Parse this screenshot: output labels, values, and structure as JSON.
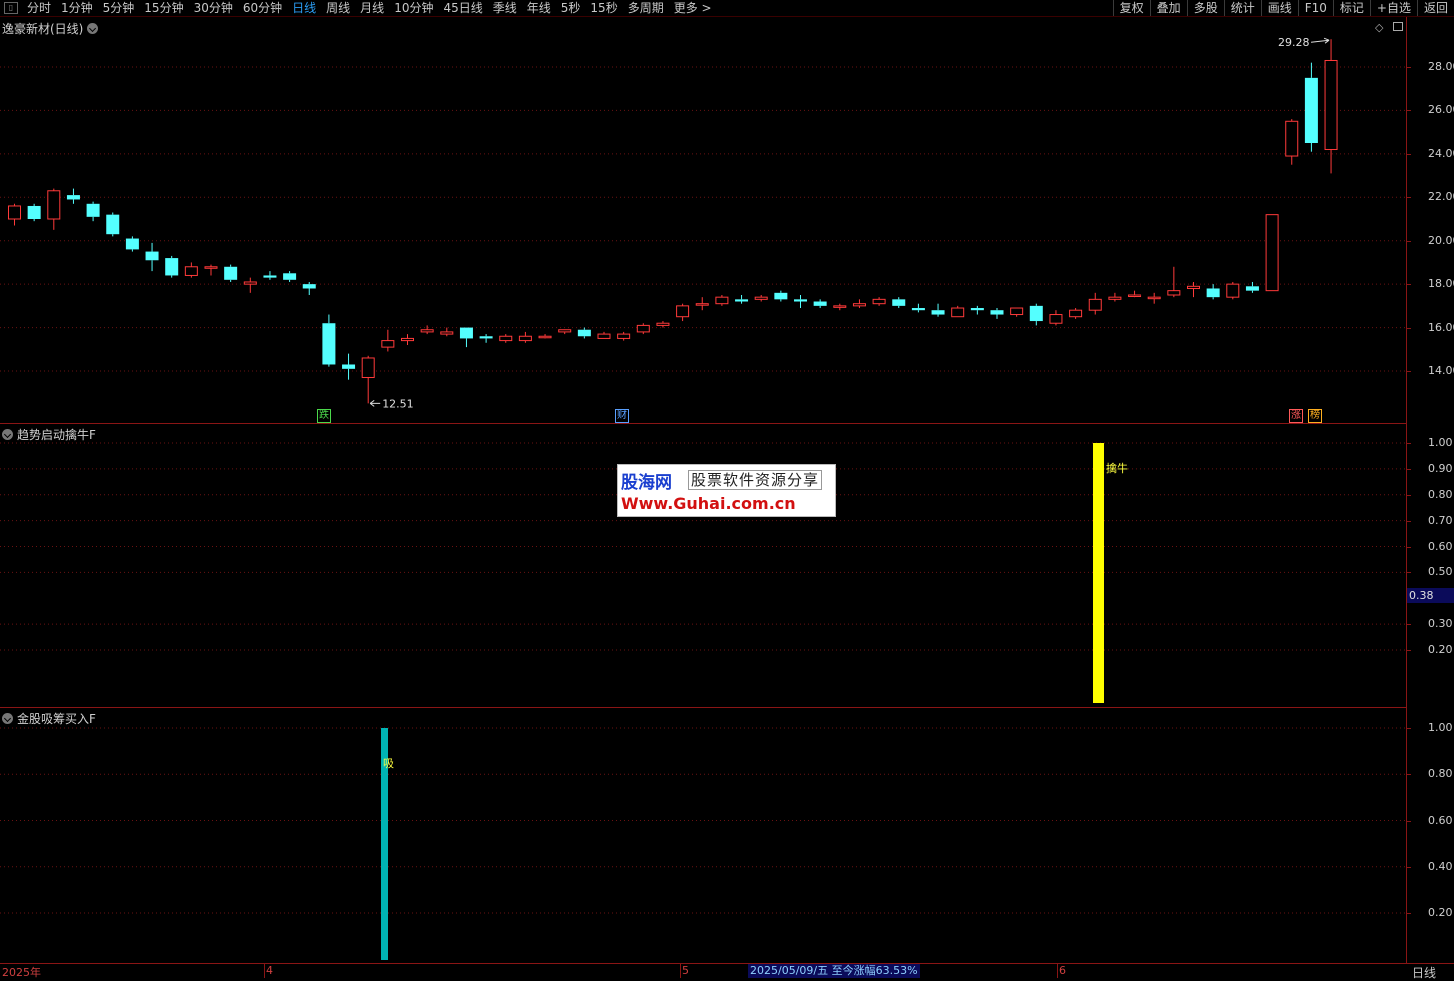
{
  "toolbar": {
    "periods": [
      "分时",
      "1分钟",
      "5分钟",
      "15分钟",
      "30分钟",
      "60分钟",
      "日线",
      "周线",
      "月线",
      "10分钟",
      "45日线",
      "季线",
      "年线",
      "5秒",
      "15秒",
      "多周期",
      "更多 >"
    ],
    "active_period": "日线",
    "right_buttons": [
      "复权",
      "叠加",
      "多股",
      "统计",
      "画线",
      "F10",
      "标记",
      "+自选",
      "返回"
    ]
  },
  "main_panel": {
    "title": "逸豪新材(日线)",
    "price_axis": [
      "28.00",
      "26.00",
      "24.00",
      "22.00",
      "20.00",
      "18.00",
      "16.00",
      "14.00"
    ],
    "high_label": "29.28",
    "low_label": "12.51",
    "markers": [
      {
        "text": "跌",
        "color": "#4bd84b"
      },
      {
        "text": "财",
        "color": "#5aa0ff"
      },
      {
        "text": "涨",
        "color": "#ff5a5a"
      },
      {
        "text": "榜",
        "color": "#ffb020"
      }
    ]
  },
  "indicator1": {
    "title": "趋势启动擒牛F",
    "axis": [
      "1.00",
      "0.90",
      "0.80",
      "0.70",
      "0.60",
      "0.50",
      "0.30",
      "0.20"
    ],
    "current_value": "0.38",
    "signal_label": "擒牛",
    "signal_color": "#ffff00"
  },
  "indicator2": {
    "title": "金股吸筹买入F",
    "axis": [
      "1.00",
      "0.80",
      "0.60",
      "0.40",
      "0.20"
    ],
    "signal_label": "吸",
    "signal_color": "#00b4b4"
  },
  "watermark": {
    "logo": "股海网",
    "slogan": "股票软件资源分享",
    "url": "Www.Guhai.com.cn"
  },
  "bottom": {
    "dates": [
      "2025年",
      "4",
      "5",
      "6"
    ],
    "status_note": "2025/05/09/五  至今涨幅63.53%",
    "period_button": "日线"
  },
  "colors": {
    "up": "#ff3a3a",
    "down": "#54ffff",
    "grid": "#8a1515"
  },
  "chart_data": {
    "type": "candlestick",
    "candles": [
      {
        "o": 21.0,
        "c": 21.6,
        "h": 21.7,
        "l": 20.7
      },
      {
        "o": 21.6,
        "c": 21.0,
        "h": 21.7,
        "l": 20.9
      },
      {
        "o": 21.0,
        "c": 22.3,
        "h": 22.4,
        "l": 20.5
      },
      {
        "o": 22.1,
        "c": 21.9,
        "h": 22.4,
        "l": 21.7
      },
      {
        "o": 21.7,
        "c": 21.1,
        "h": 21.8,
        "l": 20.9
      },
      {
        "o": 21.2,
        "c": 20.3,
        "h": 21.3,
        "l": 20.2
      },
      {
        "o": 20.1,
        "c": 19.6,
        "h": 20.2,
        "l": 19.5
      },
      {
        "o": 19.5,
        "c": 19.1,
        "h": 19.9,
        "l": 18.6
      },
      {
        "o": 19.2,
        "c": 18.4,
        "h": 19.3,
        "l": 18.3
      },
      {
        "o": 18.4,
        "c": 18.8,
        "h": 19.0,
        "l": 18.3
      },
      {
        "o": 18.8,
        "c": 18.8,
        "h": 18.9,
        "l": 18.4
      },
      {
        "o": 18.8,
        "c": 18.2,
        "h": 18.9,
        "l": 18.1
      },
      {
        "o": 18.0,
        "c": 18.1,
        "h": 18.3,
        "l": 17.6
      },
      {
        "o": 18.4,
        "c": 18.3,
        "h": 18.6,
        "l": 18.2
      },
      {
        "o": 18.5,
        "c": 18.2,
        "h": 18.6,
        "l": 18.1
      },
      {
        "o": 18.0,
        "c": 17.8,
        "h": 18.1,
        "l": 17.5
      },
      {
        "o": 16.2,
        "c": 14.3,
        "h": 16.6,
        "l": 14.2
      },
      {
        "o": 14.3,
        "c": 14.1,
        "h": 14.8,
        "l": 13.6
      },
      {
        "o": 13.7,
        "c": 14.6,
        "h": 14.7,
        "l": 12.51
      },
      {
        "o": 15.1,
        "c": 15.4,
        "h": 15.9,
        "l": 14.9
      },
      {
        "o": 15.4,
        "c": 15.5,
        "h": 15.7,
        "l": 15.2
      },
      {
        "o": 15.8,
        "c": 15.9,
        "h": 16.1,
        "l": 15.7
      },
      {
        "o": 15.7,
        "c": 15.8,
        "h": 16.0,
        "l": 15.6
      },
      {
        "o": 16.0,
        "c": 15.5,
        "h": 16.0,
        "l": 15.1
      },
      {
        "o": 15.6,
        "c": 15.5,
        "h": 15.7,
        "l": 15.3
      },
      {
        "o": 15.4,
        "c": 15.6,
        "h": 15.7,
        "l": 15.3
      },
      {
        "o": 15.4,
        "c": 15.6,
        "h": 15.8,
        "l": 15.3
      },
      {
        "o": 15.6,
        "c": 15.6,
        "h": 15.7,
        "l": 15.5
      },
      {
        "o": 15.8,
        "c": 15.9,
        "h": 15.9,
        "l": 15.7
      },
      {
        "o": 15.9,
        "c": 15.6,
        "h": 16.0,
        "l": 15.5
      },
      {
        "o": 15.5,
        "c": 15.7,
        "h": 15.8,
        "l": 15.5
      },
      {
        "o": 15.5,
        "c": 15.7,
        "h": 15.8,
        "l": 15.4
      },
      {
        "o": 15.8,
        "c": 16.1,
        "h": 16.2,
        "l": 15.7
      },
      {
        "o": 16.1,
        "c": 16.2,
        "h": 16.3,
        "l": 16.0
      },
      {
        "o": 16.5,
        "c": 17.0,
        "h": 17.1,
        "l": 16.3
      },
      {
        "o": 17.1,
        "c": 17.1,
        "h": 17.4,
        "l": 16.8
      },
      {
        "o": 17.1,
        "c": 17.4,
        "h": 17.5,
        "l": 17.0
      },
      {
        "o": 17.3,
        "c": 17.2,
        "h": 17.5,
        "l": 17.1
      },
      {
        "o": 17.3,
        "c": 17.4,
        "h": 17.5,
        "l": 17.2
      },
      {
        "o": 17.6,
        "c": 17.3,
        "h": 17.7,
        "l": 17.2
      },
      {
        "o": 17.3,
        "c": 17.2,
        "h": 17.5,
        "l": 16.9
      },
      {
        "o": 17.2,
        "c": 17.0,
        "h": 17.3,
        "l": 16.9
      },
      {
        "o": 17.0,
        "c": 17.0,
        "h": 17.1,
        "l": 16.8
      },
      {
        "o": 17.0,
        "c": 17.1,
        "h": 17.3,
        "l": 16.9
      },
      {
        "o": 17.1,
        "c": 17.3,
        "h": 17.4,
        "l": 17.0
      },
      {
        "o": 17.3,
        "c": 17.0,
        "h": 17.4,
        "l": 16.9
      },
      {
        "o": 16.9,
        "c": 16.8,
        "h": 17.1,
        "l": 16.7
      },
      {
        "o": 16.8,
        "c": 16.6,
        "h": 17.1,
        "l": 16.5
      },
      {
        "o": 16.5,
        "c": 16.9,
        "h": 17.0,
        "l": 16.5
      },
      {
        "o": 16.9,
        "c": 16.8,
        "h": 17.0,
        "l": 16.6
      },
      {
        "o": 16.8,
        "c": 16.6,
        "h": 16.9,
        "l": 16.4
      },
      {
        "o": 16.6,
        "c": 16.9,
        "h": 16.9,
        "l": 16.5
      },
      {
        "o": 17.0,
        "c": 16.3,
        "h": 17.1,
        "l": 16.1
      },
      {
        "o": 16.2,
        "c": 16.6,
        "h": 16.8,
        "l": 16.1
      },
      {
        "o": 16.5,
        "c": 16.8,
        "h": 16.9,
        "l": 16.4
      },
      {
        "o": 16.8,
        "c": 17.3,
        "h": 17.6,
        "l": 16.6
      },
      {
        "o": 17.3,
        "c": 17.4,
        "h": 17.6,
        "l": 17.2
      },
      {
        "o": 17.5,
        "c": 17.5,
        "h": 17.7,
        "l": 17.4
      },
      {
        "o": 17.4,
        "c": 17.4,
        "h": 17.6,
        "l": 17.1
      },
      {
        "o": 17.5,
        "c": 17.7,
        "h": 18.8,
        "l": 17.4
      },
      {
        "o": 17.8,
        "c": 17.9,
        "h": 18.1,
        "l": 17.4
      },
      {
        "o": 17.8,
        "c": 17.4,
        "h": 18.0,
        "l": 17.3
      },
      {
        "o": 17.4,
        "c": 18.0,
        "h": 18.1,
        "l": 17.3
      },
      {
        "o": 17.9,
        "c": 17.7,
        "h": 18.1,
        "l": 17.6
      },
      {
        "o": 17.7,
        "c": 21.2,
        "h": 21.2,
        "l": 17.7
      },
      {
        "o": 23.9,
        "c": 25.5,
        "h": 25.6,
        "l": 23.5
      },
      {
        "o": 27.5,
        "c": 24.5,
        "h": 28.2,
        "l": 24.1
      },
      {
        "o": 24.2,
        "c": 28.3,
        "h": 29.28,
        "l": 23.1
      }
    ],
    "ylim": [
      12.0,
      29.5
    ],
    "indicator1_signals": [
      {
        "index": 55,
        "value": 1.0
      }
    ],
    "indicator2_signals": [
      {
        "index": 19,
        "value": 1.0
      }
    ]
  }
}
